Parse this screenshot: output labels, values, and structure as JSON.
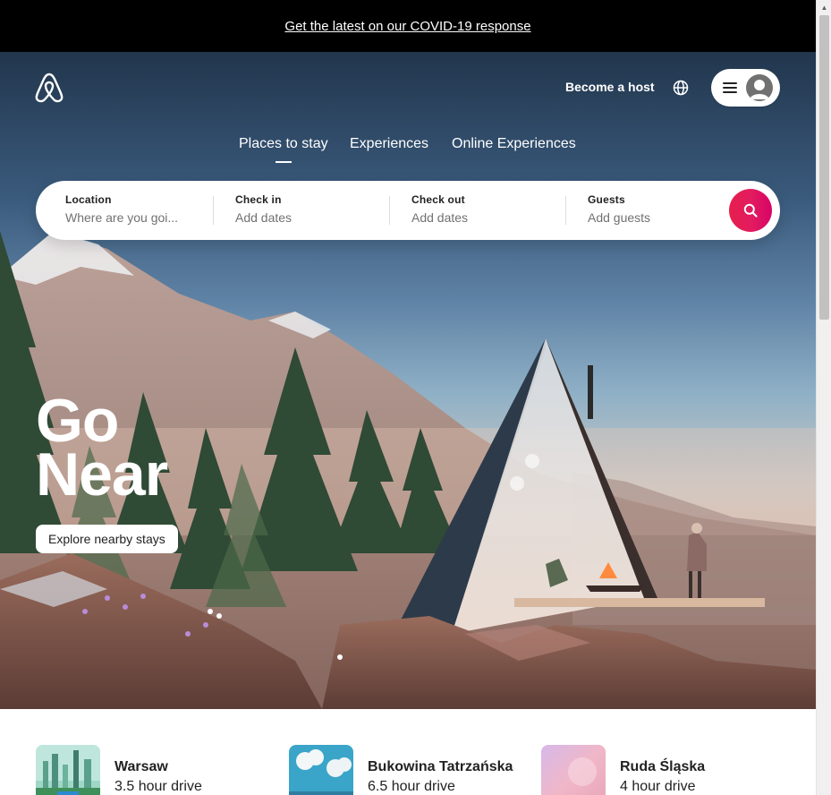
{
  "banner": {
    "link_text": "Get the latest on our COVID-19 response"
  },
  "header": {
    "logo_icon": "airbnb-logo-icon",
    "host_label": "Become a host",
    "globe_icon": "globe-icon",
    "menu_icon": "hamburger-menu-icon",
    "avatar_icon": "user-avatar-icon"
  },
  "tabs": [
    {
      "label": "Places to stay",
      "selected": true
    },
    {
      "label": "Experiences",
      "selected": false
    },
    {
      "label": "Online Experiences",
      "selected": false
    }
  ],
  "search": {
    "location": {
      "label": "Location",
      "placeholder": "Where are you goi..."
    },
    "checkin": {
      "label": "Check in",
      "placeholder": "Add dates"
    },
    "checkout": {
      "label": "Check out",
      "placeholder": "Add dates"
    },
    "guests": {
      "label": "Guests",
      "placeholder": "Add guests"
    },
    "button_icon": "search-icon",
    "accent_color": "#e61e4d"
  },
  "hero": {
    "headline_line1": "Go",
    "headline_line2": "Near",
    "cta_label": "Explore nearby stays"
  },
  "destinations": [
    {
      "name": "Warsaw",
      "distance": "3.5 hour drive"
    },
    {
      "name": "Bukowina Tatrzańska",
      "distance": "6.5 hour drive"
    },
    {
      "name": "Ruda Śląska",
      "distance": "4 hour drive"
    }
  ]
}
